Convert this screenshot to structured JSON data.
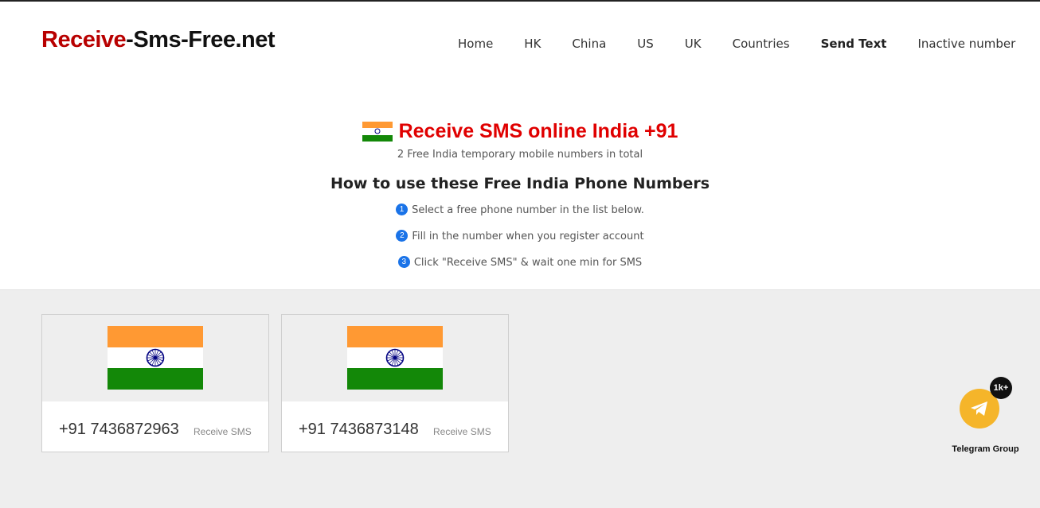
{
  "header": {
    "logo": {
      "part1": "Receive",
      "part2": "-Sms-Free.net"
    },
    "nav": [
      {
        "label": "Home"
      },
      {
        "label": "HK"
      },
      {
        "label": "China"
      },
      {
        "label": "US"
      },
      {
        "label": "UK"
      },
      {
        "label": "Countries"
      },
      {
        "label": "Send Text"
      },
      {
        "label": "Inactive number"
      }
    ]
  },
  "hero": {
    "title": "Receive SMS online India +91",
    "subtitle": "2 Free India temporary mobile numbers in total",
    "howto_title": "How to use these Free India Phone Numbers",
    "steps": [
      {
        "num": "1",
        "text": "Select a free phone number in the list below."
      },
      {
        "num": "2",
        "text": "Fill in the number when you register account"
      },
      {
        "num": "3",
        "text": "Click \"Receive SMS\" & wait one min for SMS"
      }
    ]
  },
  "numbers": [
    {
      "number": "+91 7436872963",
      "action": "Receive SMS"
    },
    {
      "number": "+91 7436873148",
      "action": "Receive SMS"
    }
  ],
  "telegram": {
    "badge": "1k+",
    "label": "Telegram Group"
  },
  "colors": {
    "brand_red": "#b80000",
    "title_red": "#e00000",
    "step_blue": "#1a73e8",
    "telegram_yellow": "#f5b52a"
  }
}
